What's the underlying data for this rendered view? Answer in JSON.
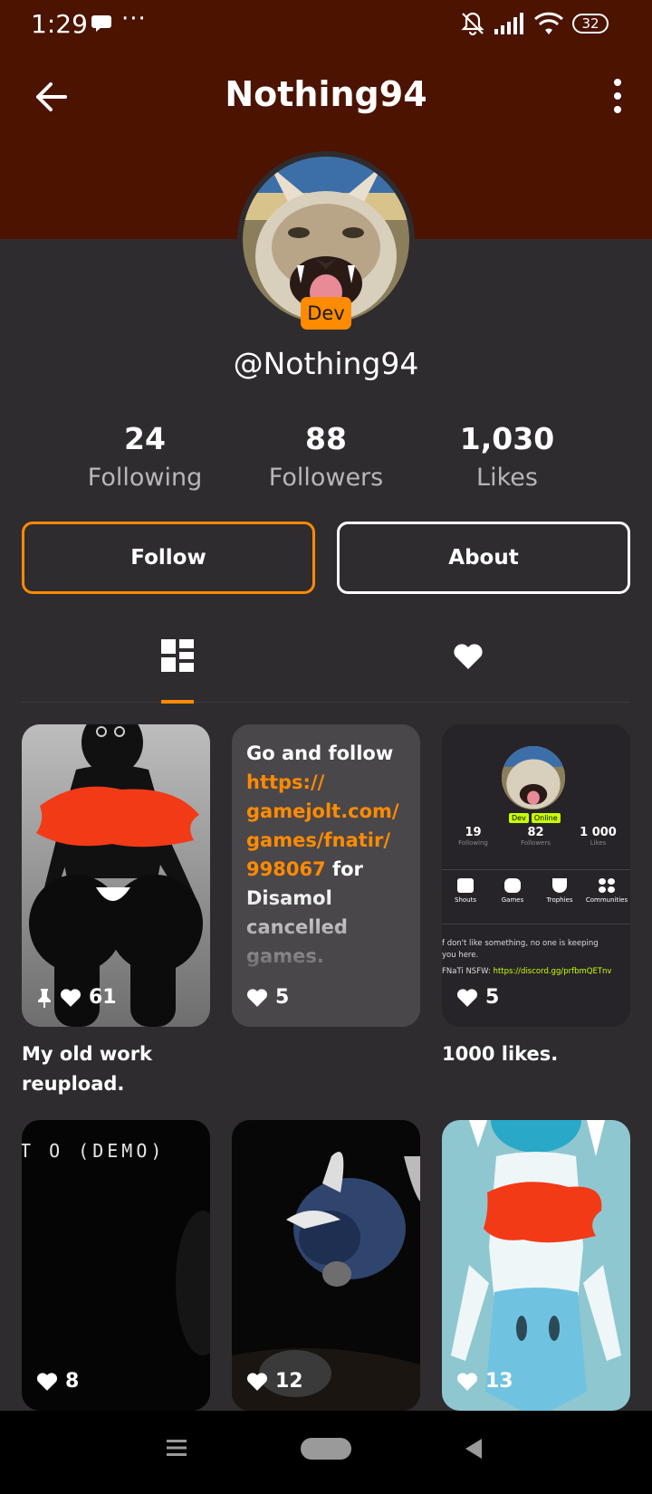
{
  "status_bar": {
    "time": "1:29",
    "dots": "···",
    "battery": "32"
  },
  "header": {
    "title": "Nothing94"
  },
  "profile": {
    "badge": "Dev",
    "handle": "@Nothing94"
  },
  "stats": [
    {
      "value": "24",
      "label": "Following"
    },
    {
      "value": "88",
      "label": "Followers"
    },
    {
      "value": "1,030",
      "label": "Likes"
    }
  ],
  "actions": {
    "follow_label": "Follow",
    "about_label": "About"
  },
  "tabs": {
    "active": "posts",
    "posts_icon": "grid-icon",
    "likes_icon": "heart-icon"
  },
  "posts": [
    {
      "likes": "61",
      "pinned": true,
      "caption": "My old work reupload."
    },
    {
      "likes": "5",
      "text_intro": "Go and follow ",
      "text_link": "https:// gamejolt.com/ games/fnatir/ 998067",
      "text_rest": " for Disamol cancelled games."
    },
    {
      "likes": "5",
      "caption": "1000 likes.",
      "mini": {
        "badges": [
          "Dev",
          "Online"
        ],
        "stats": [
          {
            "value": "19",
            "label": "Following"
          },
          {
            "value": "82",
            "label": "Followers"
          },
          {
            "value": "1 000",
            "label": "Likes"
          }
        ],
        "tabs": [
          "Shouts",
          "Games",
          "Trophies",
          "Communities"
        ],
        "line1": "f don't like something, no one is keeping",
        "line2": "you here.",
        "line3_label": "FNaTi NSFW: ",
        "line3_link": "https://discord.gg/prfbmQETnv"
      }
    },
    {
      "likes": "8",
      "overlay_text": "T O (DEMO)"
    },
    {
      "likes": "12"
    },
    {
      "likes": "13"
    }
  ],
  "colors": {
    "header": "#4b1300",
    "background": "#2f2c30",
    "accent": "#ff8b00",
    "redaction": "#f23a17"
  },
  "nav": {
    "menu_icon": "menu-icon",
    "home_icon": "home-pill-icon",
    "back_icon": "back-triangle-icon"
  }
}
